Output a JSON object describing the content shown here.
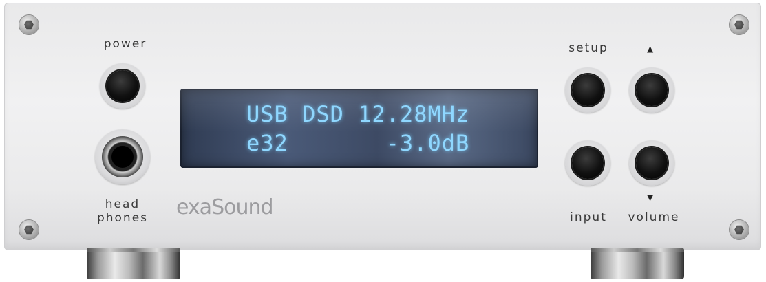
{
  "device": {
    "labels": {
      "power": "power",
      "headphones_line1": "head",
      "headphones_line2": "phones",
      "setup": "setup",
      "input": "input",
      "volume": "volume"
    },
    "display": {
      "line1": "USB DSD 12.28MHz",
      "line2": "e32       -3.0dB"
    },
    "brand_logo": "exaSound",
    "arrows": {
      "up": "▲",
      "down": "▼"
    }
  },
  "colors": {
    "display_text": "#8fd7ff",
    "panel": "#ececed",
    "button": "#111111"
  }
}
